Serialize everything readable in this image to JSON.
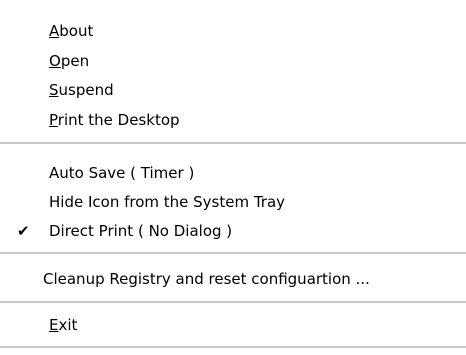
{
  "menu": {
    "groups": [
      [
        {
          "first": "A",
          "rest": "bout"
        },
        {
          "first": "O",
          "rest": "pen"
        },
        {
          "first": "S",
          "rest": "uspend"
        },
        {
          "first": "P",
          "rest": "rint the Desktop"
        }
      ],
      [
        {
          "label": "Auto Save ( Timer )"
        },
        {
          "label": "Hide Icon from the System Tray"
        },
        {
          "label": "Direct Print ( No Dialog )",
          "checked": true
        }
      ],
      [
        {
          "label": "Cleanup Registry and reset configuartion ..."
        }
      ],
      [
        {
          "first": "E",
          "rest": "xit"
        }
      ]
    ],
    "check_glyph": "✔",
    "colors": {
      "background": "#ffffff",
      "text": "#000000",
      "separator": "#c8c8c8"
    }
  }
}
